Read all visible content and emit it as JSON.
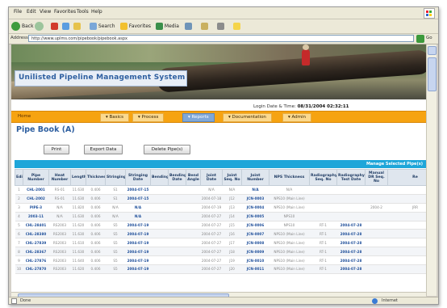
{
  "browser": {
    "menu": [
      "File",
      "Edit",
      "View",
      "Favorites",
      "Tools",
      "Help"
    ],
    "toolbar": {
      "back_label": "Back",
      "search_label": "Search",
      "favorites_label": "Favorites",
      "media_label": "Media"
    },
    "address_label": "Address",
    "address_url": "http://www.uplms.com/pipebook/pipebook.aspx",
    "go_label": "Go",
    "status_left": "Done",
    "status_right": "Internet"
  },
  "app": {
    "title": "Unilisted Pipeline Management System",
    "login_label": "Login Date & Time:",
    "login_value": "08/31/2004 02:32:11",
    "nav": {
      "home": "Home",
      "items": [
        "Basics",
        "Process",
        "Reports",
        "Documentation",
        "Admin"
      ],
      "active_index": 2
    },
    "page_title": "Pipe Book (A)",
    "buttons": {
      "print": "Print",
      "export": "Export Data",
      "delete": "Delete Pipe(s)"
    },
    "manage_link": "Manage Selected Pipe(s)"
  },
  "table": {
    "headers": [
      "Edit",
      "Pipe Number",
      "Heat Number",
      "Length",
      "Thickness",
      "Stringing",
      "Stringing Date",
      "Bending",
      "Bending Date",
      "Bend Angle",
      "Joint Date",
      "Joint Seq. No",
      "Joint Number",
      "NPS Thickness",
      "Radiography Seq. No",
      "Radiography Test Date",
      "Manual DR Seq. No",
      "Re"
    ],
    "rows": [
      [
        "1",
        "CHL-2001",
        "RS-01",
        "11.630",
        "0.406",
        "S1",
        "2004-07-15",
        "",
        "",
        "",
        "N/A",
        "N/A",
        "N/A",
        "N/A",
        "",
        "",
        "",
        ""
      ],
      [
        "2",
        "CHL-2002",
        "RS-01",
        "11.630",
        "0.406",
        "S1",
        "2004-07-15",
        "",
        "",
        "",
        "2004-07-18",
        "J12",
        "JCN-0003",
        "NPS10 (Main Line)",
        "",
        "",
        "",
        ""
      ],
      [
        "3",
        "PIPE-3",
        "N/A",
        "11.820",
        "0.406",
        "N/A",
        "N/A",
        "",
        "",
        "",
        "2004-07-19",
        "J13",
        "JCN-0004",
        "NPS10 (Main Line)",
        "",
        "",
        "2004-2",
        "JRR"
      ],
      [
        "4",
        "2003-11",
        "N/A",
        "11.630",
        "0.406",
        "N/A",
        "N/A",
        "",
        "",
        "",
        "2004-07-27",
        "J14",
        "JCN-0005",
        "NPS10",
        "",
        "",
        "",
        ""
      ],
      [
        "5",
        "CHL-28401",
        "RS2003",
        "11.620",
        "0.406",
        "S5",
        "2004-07-19",
        "",
        "",
        "",
        "2004-07-27",
        "J15",
        "JCN-0006",
        "NPS10",
        "RT-1",
        "2004-07-28",
        "",
        ""
      ],
      [
        "6",
        "CHL-28380",
        "RS2003",
        "11.630",
        "0.406",
        "S5",
        "2004-07-19",
        "",
        "",
        "",
        "2004-07-27",
        "J16",
        "JCN-0007",
        "NPS10 (Main Line)",
        "RT-1",
        "2004-07-28",
        "",
        ""
      ],
      [
        "7",
        "CHL-27839",
        "RS2003",
        "11.610",
        "0.406",
        "S5",
        "2004-07-19",
        "",
        "",
        "",
        "2004-07-27",
        "J17",
        "JCN-0008",
        "NPS10 (Main Line)",
        "RT-1",
        "2004-07-28",
        "",
        ""
      ],
      [
        "8",
        "CHL-28367",
        "RS2003",
        "11.630",
        "0.406",
        "S5",
        "2004-07-19",
        "",
        "",
        "",
        "2004-07-27",
        "J18",
        "JCN-0009",
        "NPS10 (Main Line)",
        "RT-1",
        "2004-07-28",
        "",
        ""
      ],
      [
        "9",
        "CHL-27876",
        "RS2003",
        "11.640",
        "0.406",
        "S5",
        "2004-07-19",
        "",
        "",
        "",
        "2004-07-27",
        "J19",
        "JCN-0010",
        "NPS10 (Main Line)",
        "RT-1",
        "2004-07-28",
        "",
        ""
      ],
      [
        "10",
        "CHL-27870",
        "RS2003",
        "11.620",
        "0.406",
        "S5",
        "2004-07-19",
        "",
        "",
        "",
        "2004-07-27",
        "J20",
        "JCN-0011",
        "NPS10 (Main Line)",
        "RT-1",
        "2004-07-28",
        "",
        ""
      ]
    ]
  },
  "colors": {
    "nav_orange": "#f6a311",
    "title_blue": "#2e5fa0",
    "bar_blue": "#1ea6d9",
    "link_blue": "#1f4f9a"
  },
  "icons": [
    "back-icon",
    "forward-icon",
    "stop-icon",
    "refresh-icon",
    "home-icon",
    "search-icon",
    "favorites-icon",
    "media-icon",
    "history-icon",
    "mail-icon",
    "print-icon",
    "edit-icon",
    "go-icon",
    "internet-globe-icon",
    "windows-logo-icon"
  ]
}
